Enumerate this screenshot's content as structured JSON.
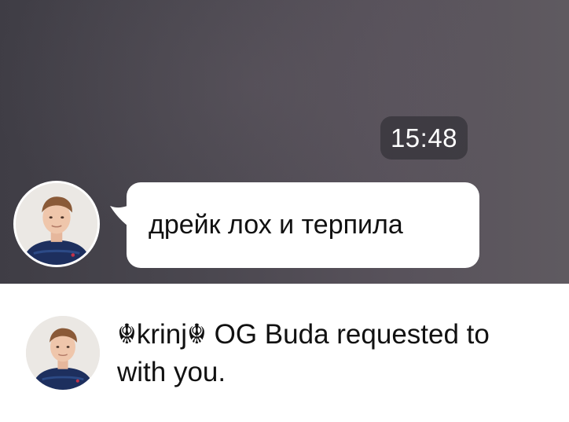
{
  "chat": {
    "timestamp": "15:48",
    "message": {
      "text": "дрейк лох и терпила"
    }
  },
  "notice": {
    "line1": "☬krinj☬ OG Buda requested to",
    "line2": "with you."
  }
}
